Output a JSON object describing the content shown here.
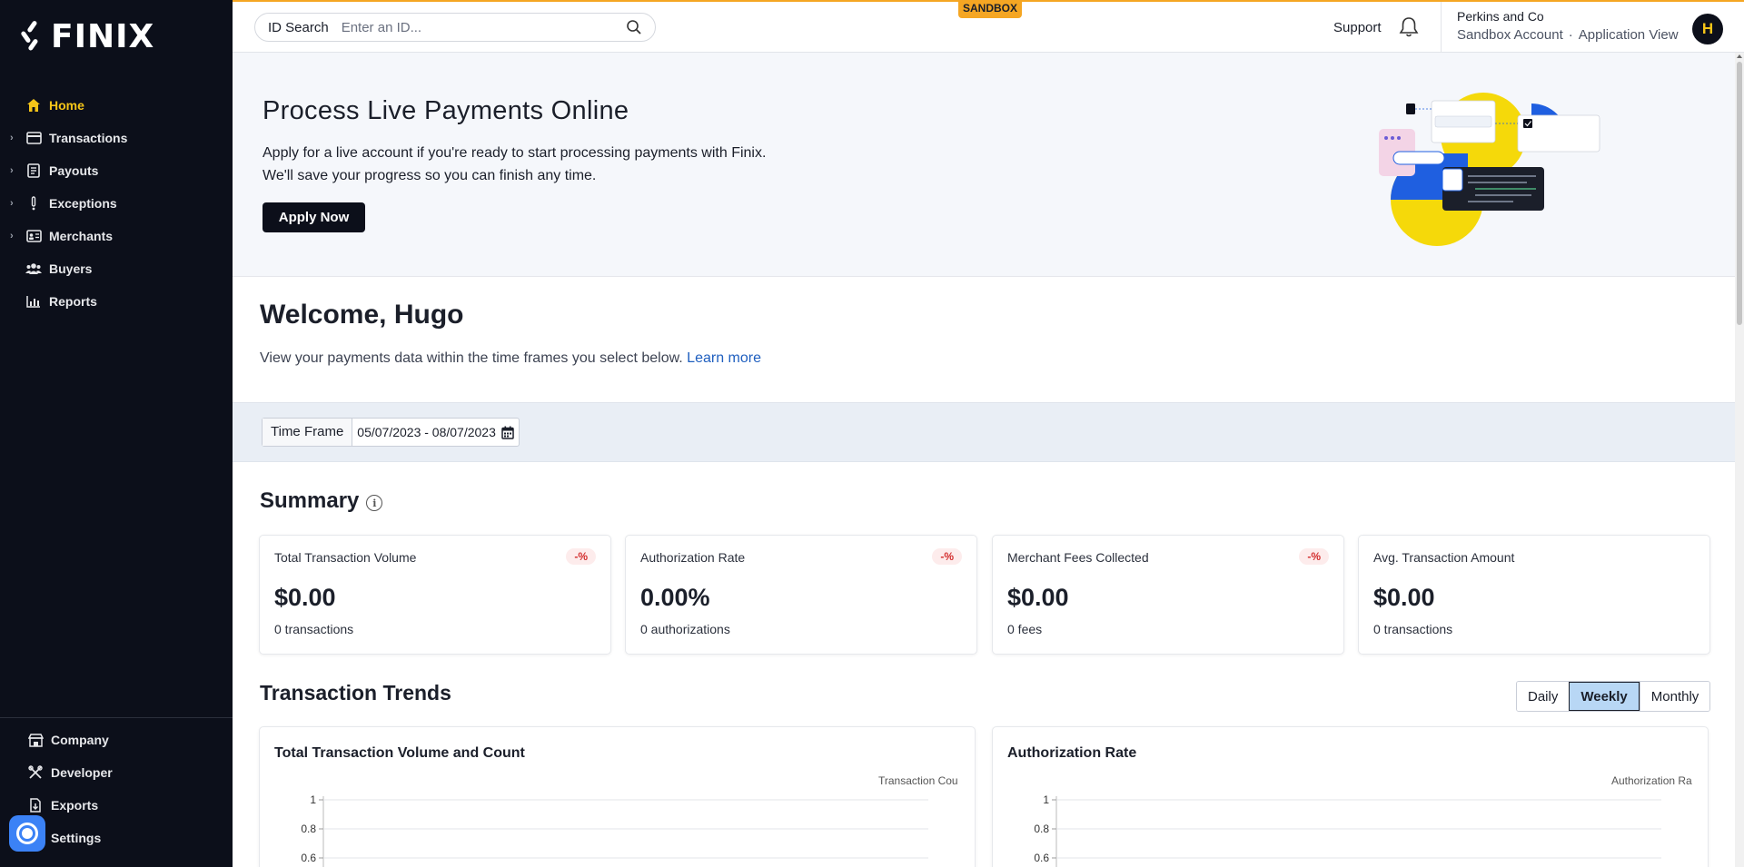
{
  "brand": {
    "name": "FINIX",
    "accent": "#f5c518",
    "sidebar_bg": "#0c0f1a"
  },
  "sidebar": {
    "items": [
      {
        "label": "Home",
        "icon": "home-icon",
        "active": true,
        "expandable": false
      },
      {
        "label": "Transactions",
        "icon": "credit-card-icon",
        "active": false,
        "expandable": true
      },
      {
        "label": "Payouts",
        "icon": "ledger-icon",
        "active": false,
        "expandable": true
      },
      {
        "label": "Exceptions",
        "icon": "exclamation-icon",
        "active": false,
        "expandable": true
      },
      {
        "label": "Merchants",
        "icon": "id-card-icon",
        "active": false,
        "expandable": true
      },
      {
        "label": "Buyers",
        "icon": "users-icon",
        "active": false,
        "expandable": false
      },
      {
        "label": "Reports",
        "icon": "bar-chart-icon",
        "active": false,
        "expandable": false
      }
    ],
    "bottom_items": [
      {
        "label": "Company",
        "icon": "building-icon"
      },
      {
        "label": "Developer",
        "icon": "tools-icon"
      },
      {
        "label": "Exports",
        "icon": "file-export-icon"
      },
      {
        "label": "Settings",
        "icon": "gear-icon"
      }
    ]
  },
  "topbar": {
    "search_label": "ID Search",
    "search_placeholder": "Enter an ID...",
    "sandbox_tag": "SANDBOX",
    "support": "Support",
    "account_name": "Perkins and Co",
    "account_type": "Sandbox Account",
    "account_sep": "·",
    "application_view": "Application View",
    "avatar_initial": "H"
  },
  "banner": {
    "title": "Process Live Payments Online",
    "text": "Apply for a live account if you're ready to start processing payments with Finix. We'll save your progress so you can finish any time.",
    "button": "Apply Now"
  },
  "welcome": {
    "title": "Welcome, Hugo",
    "text": "View your payments data within the time frames you select below.",
    "link": "Learn more"
  },
  "time_frame": {
    "label": "Time Frame",
    "value": "05/07/2023 - 08/07/2023"
  },
  "summary": {
    "title": "Summary",
    "cards": [
      {
        "label": "Total Transaction Volume",
        "badge": "-%",
        "value": "$0.00",
        "sub": "0 transactions"
      },
      {
        "label": "Authorization Rate",
        "badge": "-%",
        "value": "0.00%",
        "sub": "0 authorizations"
      },
      {
        "label": "Merchant Fees Collected",
        "badge": "-%",
        "value": "$0.00",
        "sub": "0 fees"
      },
      {
        "label": "Avg. Transaction Amount",
        "badge": "",
        "value": "$0.00",
        "sub": "0 transactions"
      }
    ]
  },
  "trends": {
    "title": "Transaction Trends",
    "periods": [
      "Daily",
      "Weekly",
      "Monthly"
    ],
    "active_period": "Weekly"
  },
  "chart_data": [
    {
      "type": "line",
      "title": "Total Transaction Volume and Count",
      "series": [
        {
          "name": "Transaction Cou",
          "values": []
        }
      ],
      "y_ticks": [
        "1",
        "0.8",
        "0.6"
      ],
      "ylim": [
        0,
        1
      ],
      "grid": true
    },
    {
      "type": "line",
      "title": "Authorization Rate",
      "series": [
        {
          "name": "Authorization Ra",
          "values": []
        }
      ],
      "y_ticks": [
        "1",
        "0.8",
        "0.6"
      ],
      "ylim": [
        0,
        1
      ],
      "grid": true
    }
  ]
}
